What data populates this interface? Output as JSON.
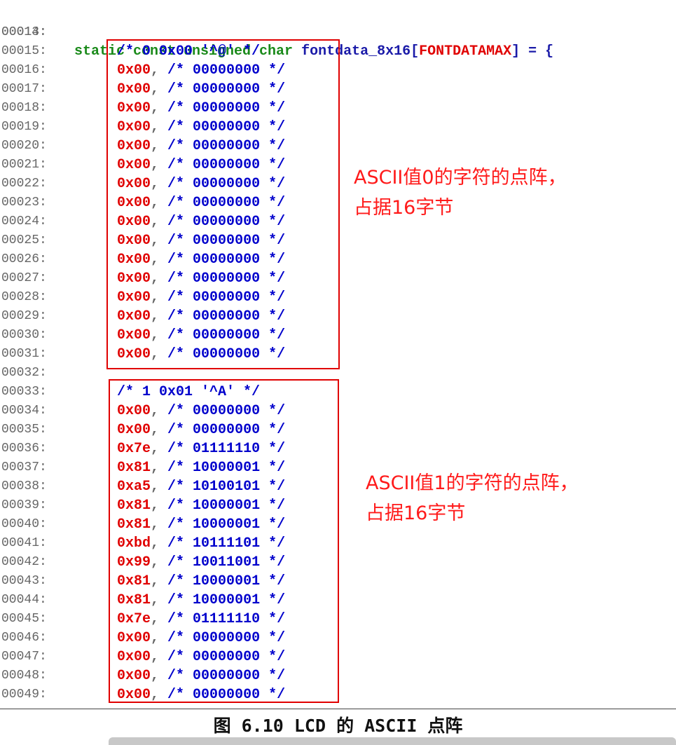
{
  "header_line": {
    "number": "00013:",
    "keyword": "static const unsigned char",
    "identifier": "fontdata_8x16",
    "open_bracket": "[",
    "macro": "FONTDATAMAX",
    "close": "] = {"
  },
  "lines": [
    {
      "n": "00014:",
      "kind": "blank"
    },
    {
      "n": "00015:",
      "kind": "comment",
      "text": "/* 0 0x00 '^@' */"
    },
    {
      "n": "00016:",
      "kind": "row",
      "hex": "0x00",
      "bits": "/* 00000000 */"
    },
    {
      "n": "00017:",
      "kind": "row",
      "hex": "0x00",
      "bits": "/* 00000000 */"
    },
    {
      "n": "00018:",
      "kind": "row",
      "hex": "0x00",
      "bits": "/* 00000000 */"
    },
    {
      "n": "00019:",
      "kind": "row",
      "hex": "0x00",
      "bits": "/* 00000000 */"
    },
    {
      "n": "00020:",
      "kind": "row",
      "hex": "0x00",
      "bits": "/* 00000000 */"
    },
    {
      "n": "00021:",
      "kind": "row",
      "hex": "0x00",
      "bits": "/* 00000000 */"
    },
    {
      "n": "00022:",
      "kind": "row",
      "hex": "0x00",
      "bits": "/* 00000000 */"
    },
    {
      "n": "00023:",
      "kind": "row",
      "hex": "0x00",
      "bits": "/* 00000000 */"
    },
    {
      "n": "00024:",
      "kind": "row",
      "hex": "0x00",
      "bits": "/* 00000000 */"
    },
    {
      "n": "00025:",
      "kind": "row",
      "hex": "0x00",
      "bits": "/* 00000000 */"
    },
    {
      "n": "00026:",
      "kind": "row",
      "hex": "0x00",
      "bits": "/* 00000000 */"
    },
    {
      "n": "00027:",
      "kind": "row",
      "hex": "0x00",
      "bits": "/* 00000000 */"
    },
    {
      "n": "00028:",
      "kind": "row",
      "hex": "0x00",
      "bits": "/* 00000000 */"
    },
    {
      "n": "00029:",
      "kind": "row",
      "hex": "0x00",
      "bits": "/* 00000000 */"
    },
    {
      "n": "00030:",
      "kind": "row",
      "hex": "0x00",
      "bits": "/* 00000000 */"
    },
    {
      "n": "00031:",
      "kind": "row",
      "hex": "0x00",
      "bits": "/* 00000000 */"
    },
    {
      "n": "00032:",
      "kind": "blank"
    },
    {
      "n": "00033:",
      "kind": "comment",
      "text": "/* 1 0x01 '^A' */"
    },
    {
      "n": "00034:",
      "kind": "row",
      "hex": "0x00",
      "bits": "/* 00000000 */"
    },
    {
      "n": "00035:",
      "kind": "row",
      "hex": "0x00",
      "bits": "/* 00000000 */"
    },
    {
      "n": "00036:",
      "kind": "row",
      "hex": "0x7e",
      "bits": "/* 01111110 */"
    },
    {
      "n": "00037:",
      "kind": "row",
      "hex": "0x81",
      "bits": "/* 10000001 */"
    },
    {
      "n": "00038:",
      "kind": "row",
      "hex": "0xa5",
      "bits": "/* 10100101 */"
    },
    {
      "n": "00039:",
      "kind": "row",
      "hex": "0x81",
      "bits": "/* 10000001 */"
    },
    {
      "n": "00040:",
      "kind": "row",
      "hex": "0x81",
      "bits": "/* 10000001 */"
    },
    {
      "n": "00041:",
      "kind": "row",
      "hex": "0xbd",
      "bits": "/* 10111101 */"
    },
    {
      "n": "00042:",
      "kind": "row",
      "hex": "0x99",
      "bits": "/* 10011001 */"
    },
    {
      "n": "00043:",
      "kind": "row",
      "hex": "0x81",
      "bits": "/* 10000001 */"
    },
    {
      "n": "00044:",
      "kind": "row",
      "hex": "0x81",
      "bits": "/* 10000001 */"
    },
    {
      "n": "00045:",
      "kind": "row",
      "hex": "0x7e",
      "bits": "/* 01111110 */"
    },
    {
      "n": "00046:",
      "kind": "row",
      "hex": "0x00",
      "bits": "/* 00000000 */"
    },
    {
      "n": "00047:",
      "kind": "row",
      "hex": "0x00",
      "bits": "/* 00000000 */"
    },
    {
      "n": "00048:",
      "kind": "row",
      "hex": "0x00",
      "bits": "/* 00000000 */"
    },
    {
      "n": "00049:",
      "kind": "row",
      "hex": "0x00",
      "bits": "/* 00000000 */"
    }
  ],
  "separator": ",",
  "annotations": {
    "char0": {
      "line1": "ASCII值0的字符的点阵，",
      "line2": "占据16字节"
    },
    "char1": {
      "line1": "ASCII值1的字符的点阵，",
      "line2": "占据16字节"
    }
  },
  "caption": "图 6.10 LCD 的 ASCII 点阵",
  "colors": {
    "keyword": "#1a8a1a",
    "identifier": "#1a1aa8",
    "hex": "#e00000",
    "comment": "#0000cc",
    "box": "#e00000",
    "annotation": "#ff1a1a"
  }
}
